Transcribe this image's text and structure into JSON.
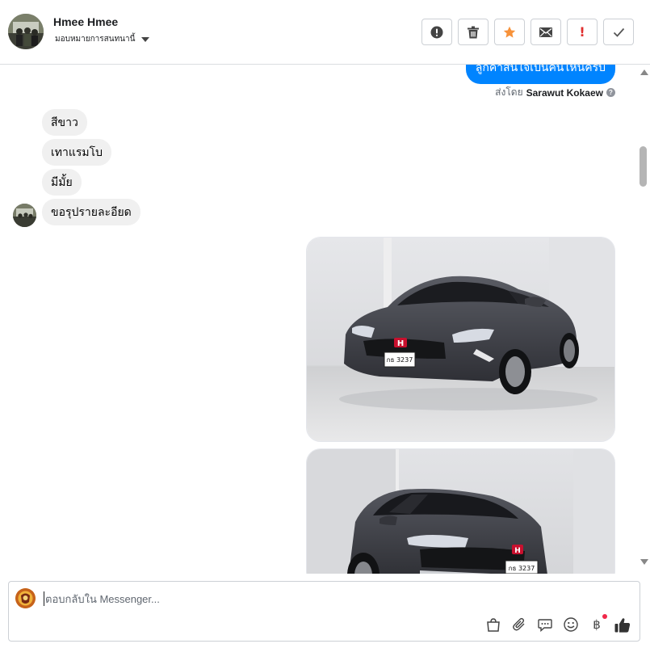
{
  "header": {
    "contact_name": "Hmee Hmee",
    "assign_label": "มอบหมายการสนทนานี้",
    "actions": [
      {
        "name": "mark-spam-button",
        "icon": "alert-circle-icon"
      },
      {
        "name": "delete-button",
        "icon": "trash-icon"
      },
      {
        "name": "star-button",
        "icon": "star-icon"
      },
      {
        "name": "mark-unread-button",
        "icon": "envelope-icon"
      },
      {
        "name": "flag-important-button",
        "icon": "exclamation-icon"
      },
      {
        "name": "mark-done-button",
        "icon": "check-icon"
      }
    ]
  },
  "thread": {
    "sent_top_text": "ลูกค้าสนใจเป็นคันไหนครับ",
    "sent_by_prefix": "ส่งโดย",
    "sent_by_name": "Sarawut Kokaew",
    "sent_by_help": "?",
    "incoming": [
      "สีขาว",
      "เทาแรมโบ",
      "มีมั้ย",
      "ขอรุปรายละอียด"
    ],
    "images": [
      {
        "name": "car-photo-1",
        "plate": "กธ 3237",
        "badge": "H"
      },
      {
        "name": "car-photo-2",
        "plate": "กธ 3237",
        "badge": "H"
      }
    ]
  },
  "composer": {
    "placeholder": "ตอบกลับใน Messenger...",
    "value": "",
    "tools": [
      "saved-replies-icon",
      "attachment-icon",
      "quick-reply-icon",
      "emoji-icon",
      "payment-icon",
      "thumbs-up-icon"
    ],
    "baht_symbol": "฿"
  },
  "colors": {
    "accent": "#0084ff",
    "incoming_bubble": "#f0f0f0",
    "star": "#f7923a",
    "alert": "#e02e2e",
    "notification_dot": "#f02849"
  }
}
